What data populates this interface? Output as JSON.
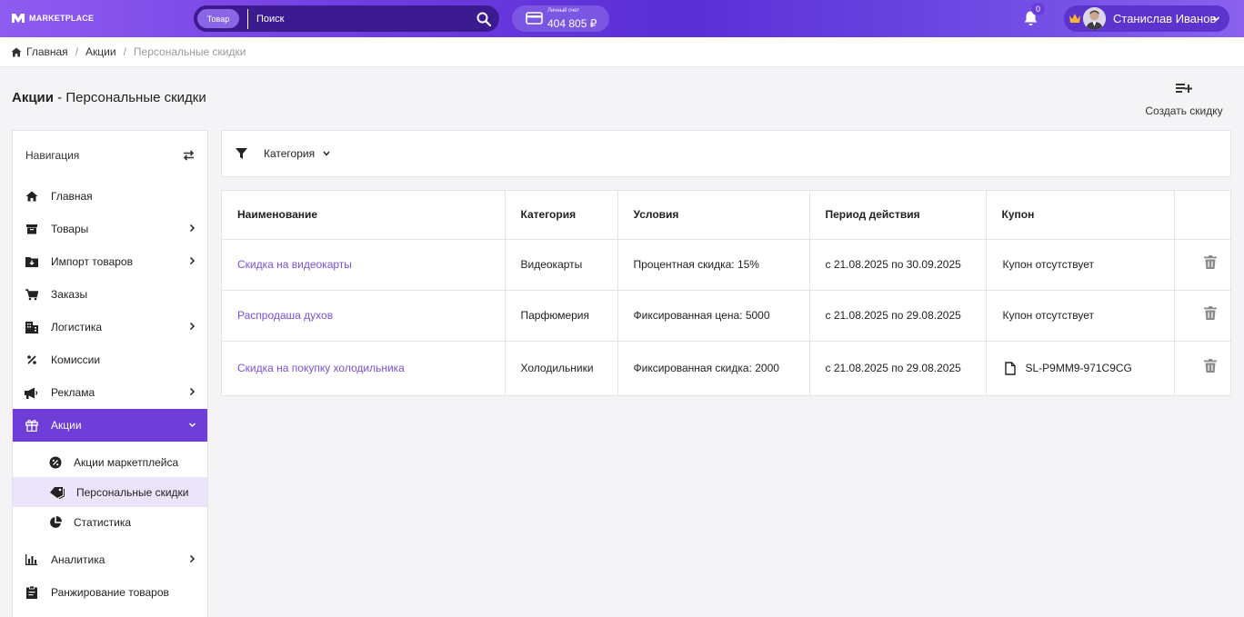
{
  "header": {
    "logo_text": "MARKETPLACE",
    "search": {
      "scope_label": "Товар",
      "placeholder": "Поиск"
    },
    "account": {
      "label": "Личный счет",
      "balance": "404 805 ₽"
    },
    "notifications_count": "0",
    "user_name": "Станислав Иванов"
  },
  "breadcrumb": {
    "items": [
      "Главная",
      "Акции"
    ],
    "current": "Персональные скидки",
    "separator": "/"
  },
  "page": {
    "title_bold": "Акции",
    "title_dash": " - ",
    "title_rest": "Персональные скидки",
    "create_label": "Создать скидку"
  },
  "sidebar": {
    "heading": "Навигация",
    "items": [
      {
        "label": "Главная",
        "icon": "home-icon"
      },
      {
        "label": "Товары",
        "icon": "box-icon"
      },
      {
        "label": "Импорт товаров",
        "icon": "folder-download-icon"
      },
      {
        "label": "Заказы",
        "icon": "cart-icon"
      },
      {
        "label": "Логистика",
        "icon": "building-icon"
      },
      {
        "label": "Комиссии",
        "icon": "percent-icon"
      },
      {
        "label": "Реклама",
        "icon": "megaphone-icon"
      },
      {
        "label": "Акции",
        "icon": "gift-icon"
      },
      {
        "label": "Аналитика",
        "icon": "bar-chart-icon"
      },
      {
        "label": "Ранжирование товаров",
        "icon": "clipboard-icon"
      }
    ],
    "subitems": [
      {
        "label": "Акции маркетплейса",
        "icon": "percent-badge-icon"
      },
      {
        "label": "Персональные скидки",
        "icon": "tags-icon"
      },
      {
        "label": "Статистика",
        "icon": "pie-chart-icon"
      }
    ]
  },
  "filter": {
    "label": "Категория"
  },
  "table": {
    "headers": [
      "Наименование",
      "Категория",
      "Условия",
      "Период действия",
      "Купон",
      ""
    ],
    "rows": [
      {
        "name": "Скидка на видеокарты",
        "category": "Видеокарты",
        "conditions": "Процентная скидка: 15%",
        "period": "с 21.08.2025 по 30.09.2025",
        "coupon": "Купон отсутствует"
      },
      {
        "name": "Распродаша духов",
        "category": "Парфюмерия",
        "conditions": "Фиксированная цена: 5000",
        "period": "с 21.08.2025 по 29.08.2025",
        "coupon": "Купон отсутствует"
      },
      {
        "name": "Скидка на покупку холодильника",
        "category": "Холодильники",
        "conditions": "Фиксированная скидка: 2000",
        "period": "с 21.08.2025 по 29.08.2025",
        "coupon": "SL-P9MM9-971C9CG"
      }
    ]
  },
  "colors": {
    "accent": "#6f3ed9",
    "link": "#7a50d9",
    "selected_bg": "#ece4fb"
  }
}
